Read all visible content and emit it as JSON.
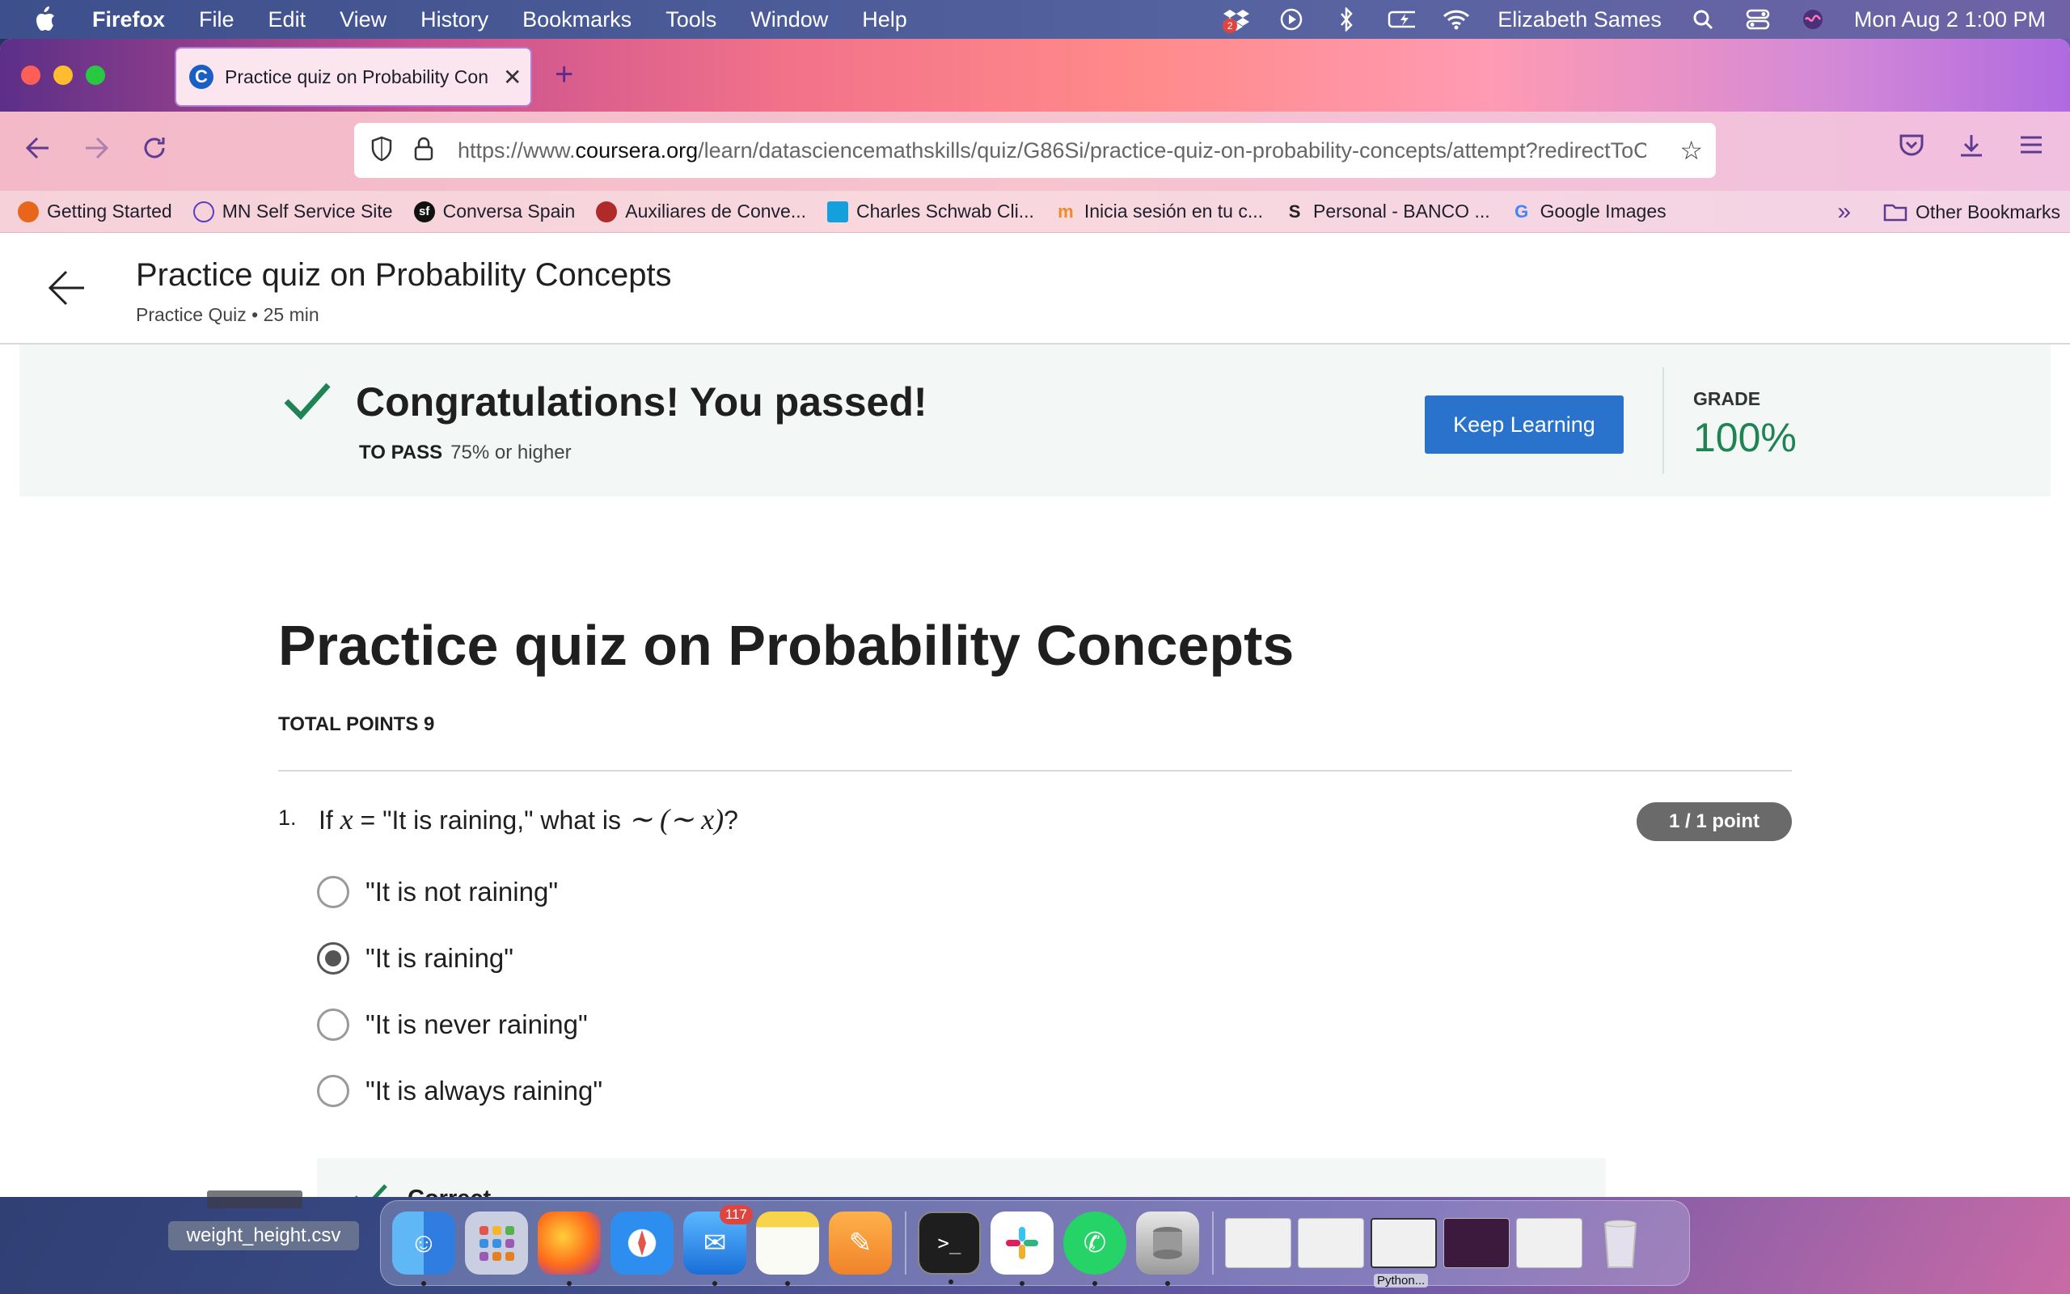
{
  "menubar": {
    "app_name": "Firefox",
    "menus": [
      "File",
      "Edit",
      "View",
      "History",
      "Bookmarks",
      "Tools",
      "Window",
      "Help"
    ],
    "dropbox_badge": "2",
    "user_name": "Elizabeth Sames",
    "datetime": "Mon Aug 2  1:00 PM"
  },
  "browser": {
    "tab_title": "Practice quiz on Probability Con",
    "tab_favicon": "C",
    "url_prefix": "https://www.",
    "url_domain": "coursera.org",
    "url_path": "/learn/datasciencemathskills/quiz/G86Si/practice-quiz-on-probability-concepts/attempt?redirectToCover=true",
    "bookmarks": [
      {
        "label": "Getting Started",
        "icon": "firefox-icon",
        "color": "#e8661c"
      },
      {
        "label": "MN Self Service Site",
        "icon": "globe-icon",
        "color": "#5a3fc0"
      },
      {
        "label": "Conversa Spain",
        "icon": "conversa-icon",
        "color": "#111111"
      },
      {
        "label": "Auxiliares de Conve...",
        "icon": "flag-icon",
        "color": "#b02a2a"
      },
      {
        "label": "Charles Schwab Cli...",
        "icon": "schwab-icon",
        "color": "#14a0dc"
      },
      {
        "label": "Inicia sesión en tu c...",
        "icon": "moodle-icon",
        "color": "#f08a24"
      },
      {
        "label": "Personal - BANCO ...",
        "icon": "banco-icon",
        "color": "#222222"
      },
      {
        "label": "Google Images",
        "icon": "google-icon",
        "color": "#4285f4"
      }
    ],
    "other_bookmarks": "Other Bookmarks"
  },
  "page": {
    "header_title": "Practice quiz on Probability Concepts",
    "header_subtitle": "Practice Quiz • 25 min",
    "banner": {
      "headline": "Congratulations! You passed!",
      "to_pass_label": "TO PASS",
      "to_pass_value": "75% or higher",
      "keep_learning": "Keep Learning",
      "grade_label": "GRADE",
      "grade_value": "100%"
    },
    "quiz_title": "Practice quiz on Probability Concepts",
    "total_points": "TOTAL POINTS 9",
    "question": {
      "number": "1.",
      "text_1": "If ",
      "var_x": "x",
      "text_2": " = \"It is raining,\" what is ",
      "expr": "∼ (∼ x)",
      "text_3": "?",
      "points": "1 / 1 point",
      "options": [
        {
          "label": "\"It is not raining\"",
          "selected": false
        },
        {
          "label": "\"It is raining\"",
          "selected": true
        },
        {
          "label": "\"It is never raining\"",
          "selected": false
        },
        {
          "label": "\"It is always raining\"",
          "selected": false
        }
      ],
      "feedback": "Correct"
    }
  },
  "desktop": {
    "file_label": "weight_height.csv",
    "mail_badge": "117",
    "python_label": "Python..."
  },
  "colors": {
    "accent_blue": "#2a73cc",
    "success_green": "#1f8354"
  }
}
